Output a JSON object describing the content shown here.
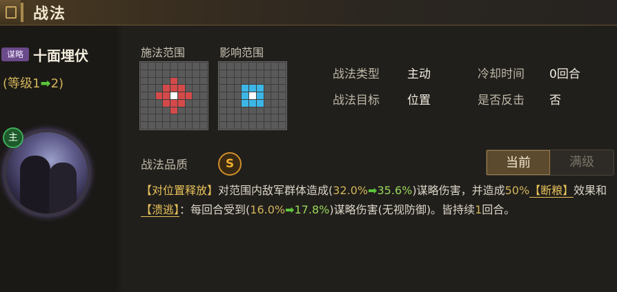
{
  "header": {
    "title": "战法"
  },
  "skill": {
    "tag": "谋略",
    "name": "十面埋伏",
    "level_prefix": "(等级1",
    "level_arrow": "➡",
    "level_suffix": "2)",
    "main_badge": "主"
  },
  "grids": {
    "cast_label": "施法范围",
    "effect_label": "影响范围"
  },
  "info": {
    "type_label": "战法类型",
    "type_value": "主动",
    "cooldown_label": "冷却时间",
    "cooldown_value": "0回合",
    "target_label": "战法目标",
    "target_value": "位置",
    "counter_label": "是否反击",
    "counter_value": "否"
  },
  "quality": {
    "label": "战法品质",
    "grade": "S"
  },
  "toggle": {
    "current": "当前",
    "max": "满级"
  },
  "description": {
    "p1": "【对位置释放】",
    "p2": "对范围内敌军群体造成(",
    "v1a": "32.0%",
    "a1": "➡",
    "v1b": "35.6%",
    "p3": ")谋略伤害，并造成",
    "v2": "50%",
    "k1": "【断粮】",
    "p4": "效果和",
    "k2": "【溃逃】",
    "p5": "：每回合受到(",
    "v3a": "16.0%",
    "a2": "➡",
    "v3b": "17.8%",
    "p6": ")谋略伤害(无视防御)。皆持续",
    "v4": "1",
    "p7": "回合。"
  },
  "colors": {
    "cast_cell": "#d44a4a",
    "effect_cell": "#3cb6e6",
    "center_cell": "#ffffff",
    "keyword": "#e8c25a",
    "arrow": "#5cc43a"
  }
}
